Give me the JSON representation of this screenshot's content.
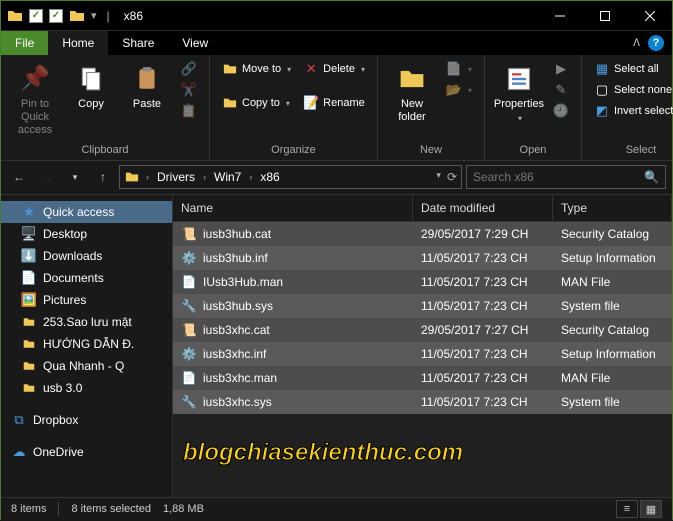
{
  "title": "x86",
  "tabs": {
    "file": "File",
    "home": "Home",
    "share": "Share",
    "view": "View"
  },
  "ribbon": {
    "clipboard": {
      "label": "Clipboard",
      "pin": "Pin to Quick access",
      "copy": "Copy",
      "paste": "Paste"
    },
    "organize": {
      "label": "Organize",
      "moveto": "Move to",
      "copyto": "Copy to",
      "delete": "Delete",
      "rename": "Rename"
    },
    "new": {
      "label": "New",
      "newfolder": "New folder"
    },
    "open": {
      "label": "Open",
      "properties": "Properties"
    },
    "select": {
      "label": "Select",
      "all": "Select all",
      "none": "Select none",
      "invert": "Invert selection"
    }
  },
  "breadcrumb": [
    "Drivers",
    "Win7",
    "x86"
  ],
  "search_placeholder": "Search x86",
  "sidebar": {
    "quick": "Quick access",
    "desktop": "Desktop",
    "downloads": "Downloads",
    "documents": "Documents",
    "pictures": "Pictures",
    "f1": "253.Sao lưu mật",
    "f2": "HƯỚNG DẪN Đ.",
    "f3": "Qua Nhanh - Q",
    "f4": "usb 3.0",
    "dropbox": "Dropbox",
    "onedrive": "OneDrive"
  },
  "columns": {
    "name": "Name",
    "date": "Date modified",
    "type": "Type"
  },
  "files": [
    {
      "name": "iusb3hub.cat",
      "date": "29/05/2017 7:29 CH",
      "type": "Security Catalog",
      "ico": "cat"
    },
    {
      "name": "iusb3hub.inf",
      "date": "11/05/2017 7:23 CH",
      "type": "Setup Information",
      "ico": "inf"
    },
    {
      "name": "IUsb3Hub.man",
      "date": "11/05/2017 7:23 CH",
      "type": "MAN File",
      "ico": "file"
    },
    {
      "name": "iusb3hub.sys",
      "date": "11/05/2017 7:23 CH",
      "type": "System file",
      "ico": "sys"
    },
    {
      "name": "iusb3xhc.cat",
      "date": "29/05/2017 7:27 CH",
      "type": "Security Catalog",
      "ico": "cat"
    },
    {
      "name": "iusb3xhc.inf",
      "date": "11/05/2017 7:23 CH",
      "type": "Setup Information",
      "ico": "inf"
    },
    {
      "name": "iusb3xhc.man",
      "date": "11/05/2017 7:23 CH",
      "type": "MAN File",
      "ico": "file"
    },
    {
      "name": "iusb3xhc.sys",
      "date": "11/05/2017 7:23 CH",
      "type": "System file",
      "ico": "sys"
    }
  ],
  "status": {
    "count": "8 items",
    "selected": "8 items selected",
    "size": "1,88 MB"
  },
  "watermark": "blogchiasekienthuc.com"
}
